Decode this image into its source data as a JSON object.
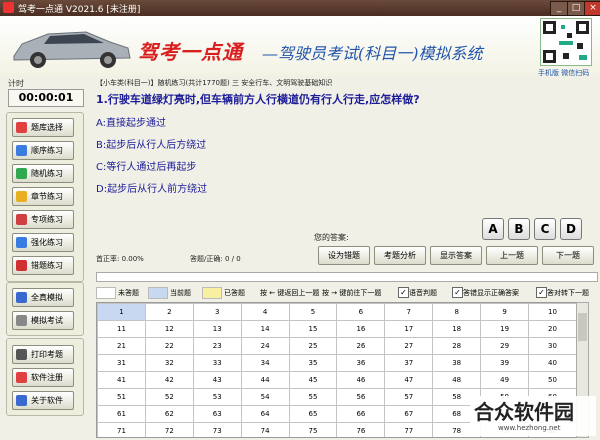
{
  "window": {
    "title": "驾考一点通 V2021.6 [未注册]",
    "min": "_",
    "max": "□",
    "close": "×"
  },
  "banner": {
    "logo": "驾考一点通",
    "subtitle": "—驾驶员考试(科目一)模拟系统",
    "qr_caption": "手机版 微信扫码"
  },
  "left": {
    "timer_label": "计时",
    "timer": "00:00:01",
    "buttons": [
      {
        "label": "题库选择",
        "icon": "library-icon",
        "color": "#e04040"
      },
      {
        "label": "顺序练习",
        "icon": "sequence-icon",
        "color": "#3a7de0"
      },
      {
        "label": "随机练习",
        "icon": "random-icon",
        "color": "#2fa84f"
      },
      {
        "label": "章节练习",
        "icon": "chapter-icon",
        "color": "#e8b020"
      },
      {
        "label": "专项练习",
        "icon": "special-icon",
        "color": "#d04040"
      },
      {
        "label": "强化练习",
        "icon": "intensive-icon",
        "color": "#3a7de0"
      },
      {
        "label": "错题练习",
        "icon": "wrong-icon",
        "color": "#d03030"
      },
      {
        "label": "全真模拟",
        "icon": "simulation-icon",
        "color": "#3a6ad0"
      },
      {
        "label": "模拟考试",
        "icon": "exam-icon",
        "color": "#888888"
      },
      {
        "label": "打印考题",
        "icon": "print-icon",
        "color": "#555555"
      },
      {
        "label": "软件注册",
        "icon": "register-icon",
        "color": "#e04040"
      },
      {
        "label": "关于软件",
        "icon": "about-icon",
        "color": "#3a6ad0"
      }
    ]
  },
  "question": {
    "category": "【小车类(科目一)】随机练习(共计1770题) 三 安全行车、文明驾驶基础知识",
    "text": "1.行驶车道绿灯亮时,但车辆前方人行横道仍有行人行走,应怎样做?",
    "options": [
      "A:直接起步通过",
      "B:起步后从行人后方绕过",
      "C:等行人通过后再起步",
      "D:起步后从行人前方绕过"
    ]
  },
  "answer": {
    "label": "您的答案:",
    "choices": [
      "A",
      "B",
      "C",
      "D"
    ],
    "accuracy": "首正率: 0.00%",
    "progress": "答题/正确: 0 / 0"
  },
  "actions": [
    "设为错题",
    "考题分析",
    "显示答案",
    "上一题",
    "下一题"
  ],
  "legend": {
    "unanswered": "未答题",
    "current": "当前题",
    "answered": "已答题",
    "prev_hint": "按 ← 键返回上一题",
    "next_hint": "按 → 键前往下一题",
    "opt1": "语音判题",
    "opt2": "答错显示正确答案",
    "opt3": "答对转下一题",
    "colors": {
      "unanswered": "#ffffff",
      "current": "#c8d8f0",
      "answered": "#f8f0a0"
    }
  },
  "grid": [
    [
      "1",
      "2",
      "3",
      "4",
      "5",
      "6",
      "7",
      "8",
      "9",
      "10"
    ],
    [
      "11",
      "12",
      "13",
      "14",
      "15",
      "16",
      "17",
      "18",
      "19",
      "20"
    ],
    [
      "21",
      "22",
      "23",
      "24",
      "25",
      "26",
      "27",
      "28",
      "29",
      "30"
    ],
    [
      "31",
      "32",
      "33",
      "34",
      "35",
      "36",
      "37",
      "38",
      "39",
      "40"
    ],
    [
      "41",
      "42",
      "43",
      "44",
      "45",
      "46",
      "47",
      "48",
      "49",
      "50"
    ],
    [
      "51",
      "52",
      "53",
      "54",
      "55",
      "56",
      "57",
      "58",
      "59",
      "60"
    ],
    [
      "61",
      "62",
      "63",
      "64",
      "65",
      "66",
      "67",
      "68",
      "69",
      "70"
    ],
    [
      "71",
      "72",
      "73",
      "74",
      "75",
      "76",
      "77",
      "78",
      "79",
      "80"
    ]
  ],
  "watermark": {
    "brand": "合众软件园",
    "url": "www.hezhong.net"
  }
}
